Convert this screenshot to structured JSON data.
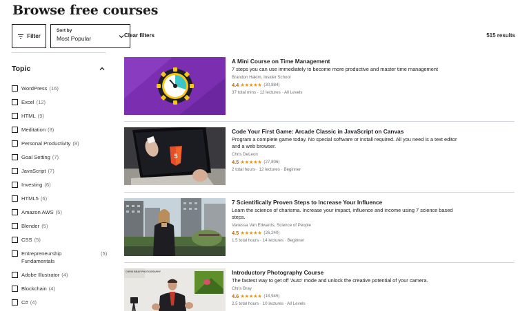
{
  "page_title": "Browse free courses",
  "toolbar": {
    "filter_label": "Filter",
    "sort_label": "Sort by",
    "sort_value": "Most Popular",
    "clear_filters": "Clear filters",
    "result_count": "515 results"
  },
  "sidebar": {
    "topic_title": "Topic",
    "topics": [
      {
        "label": "WordPress",
        "count": "(16)"
      },
      {
        "label": "Excel",
        "count": "(12)"
      },
      {
        "label": "HTML",
        "count": "(9)"
      },
      {
        "label": "Meditation",
        "count": "(8)"
      },
      {
        "label": "Personal Productivity",
        "count": "(8)"
      },
      {
        "label": "Goal Setting",
        "count": "(7)"
      },
      {
        "label": "JavaScript",
        "count": "(7)"
      },
      {
        "label": "Investing",
        "count": "(6)"
      },
      {
        "label": "HTML5",
        "count": "(6)"
      },
      {
        "label": "Amazon AWS",
        "count": "(5)"
      },
      {
        "label": "Blender",
        "count": "(5)"
      },
      {
        "label": "CSS",
        "count": "(5)"
      },
      {
        "label": "Entrepreneurship Fundamentals",
        "count": "(5)"
      },
      {
        "label": "Adobe Illustrator",
        "count": "(4)"
      },
      {
        "label": "Blockchain",
        "count": "(4)"
      },
      {
        "label": "C#",
        "count": "(4)"
      }
    ]
  },
  "courses": [
    {
      "title": "A Mini Course on Time Management",
      "description": "7 steps you can use immediately to become more productive and master time management",
      "author": "Brandon Hakim, Insider School",
      "rating": "4.4",
      "stars": "★★★★★",
      "reviews": "(30,884)",
      "meta": "37 total mins · 12 lectures · All Levels"
    },
    {
      "title": "Code Your First Game: Arcade Classic in JavaScript on Canvas",
      "description": "Program a complete game today. No special software or install required. All you need is a text editor and a web browser.",
      "author": "Chris DeLeon",
      "rating": "4.5",
      "stars": "★★★★★",
      "reviews": "(27,806)",
      "meta": "2 total hours · 12 lectures · Beginner"
    },
    {
      "title": "7 Scientifically Proven Steps to Increase Your Influence",
      "description": "Learn the science of charisma. Increase your impact, influence and income using 7 science based steps.",
      "author": "Vanessa Van Edwards, Science of People",
      "rating": "4.5",
      "stars": "★★★★★",
      "reviews": "(26,240)",
      "meta": "1.5 total hours · 14 lectures · Beginner"
    },
    {
      "title": "Introductory Photography Course",
      "description": "The fastest way to get off 'Auto' mode and unlock the creative potential of your camera.",
      "author": "Chris Bray",
      "rating": "4.6",
      "stars": "★★★★★",
      "reviews": "(18,945)",
      "meta": "2.5 total hours · 10 lectures · All Levels"
    }
  ],
  "thumbnails": {
    "course_1": "clock-illustration",
    "course_2": "laptop-html5-image",
    "course_3": "woman-on-balcony-image",
    "course_4": "photographer-studio-image",
    "course_4_sign": "CHRIS BRAY PHOTOGRAPHY"
  },
  "colors": {
    "rating": "#b4690e",
    "stars": "#e59819",
    "text": "#1c1d1f",
    "muted": "#6a6f73",
    "border": "#d1d7dc"
  }
}
